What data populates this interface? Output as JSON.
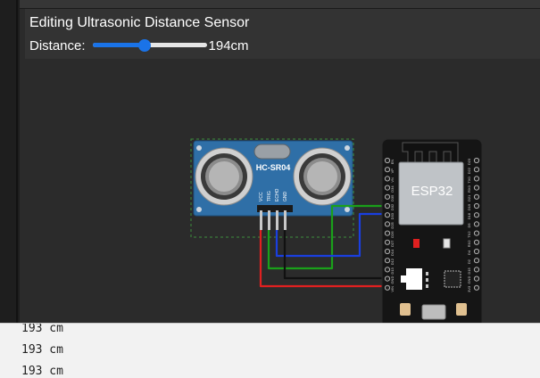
{
  "editor": {
    "title": "Editing Ultrasonic Distance Sensor",
    "distance_label": "Distance:",
    "distance_value": 194,
    "distance_unit": "cm",
    "distance_display": "194cm",
    "distance_min": 2,
    "distance_max": 400
  },
  "sensor": {
    "model": "HC-SR04",
    "pins": [
      "VCC",
      "TRIG",
      "ECHO",
      "GND"
    ]
  },
  "board": {
    "label": "ESP32",
    "left_pins": [
      "EN",
      "VP",
      "VN",
      "D34",
      "D35",
      "D32",
      "D33",
      "D25",
      "D26",
      "D27",
      "D14",
      "D12",
      "D13",
      "GND",
      "VIN"
    ],
    "right_pins": [
      "D23",
      "D22",
      "TX0",
      "RX0",
      "D21",
      "D19",
      "D18",
      "D5",
      "TX2",
      "RX2",
      "D4",
      "D2",
      "D15",
      "GND",
      "3V3"
    ]
  },
  "wires": [
    {
      "name": "vcc-wire",
      "color": "#e02020"
    },
    {
      "name": "trig-wire",
      "color": "#1aa01a"
    },
    {
      "name": "echo-wire",
      "color": "#1a3fe0"
    },
    {
      "name": "gnd-wire",
      "color": "#111111"
    }
  ],
  "console": {
    "lines": [
      "193 cm",
      "193 cm",
      "193 cm"
    ]
  }
}
